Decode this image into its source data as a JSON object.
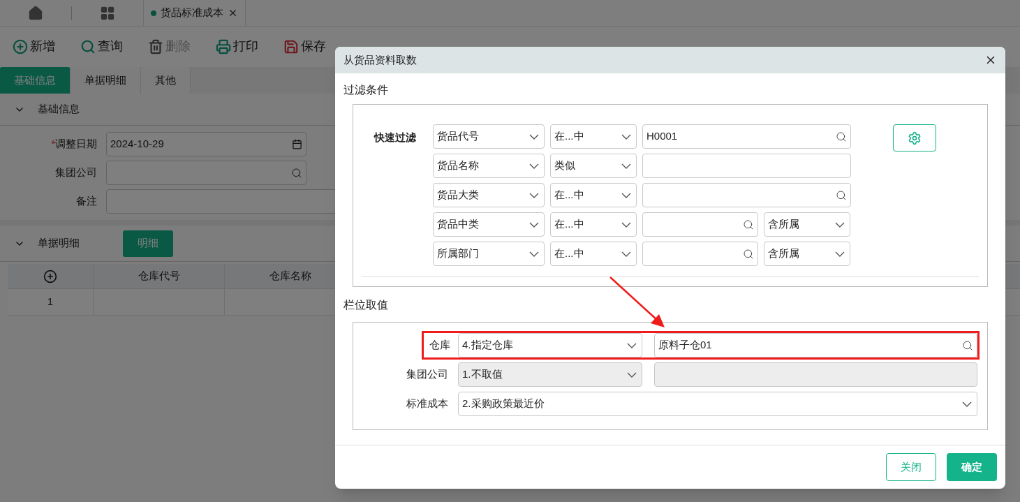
{
  "app_tabs": {
    "document_tab": {
      "label": "货品标准成本"
    }
  },
  "toolbar": [
    {
      "label": "新增",
      "disabled": false
    },
    {
      "label": "查询",
      "disabled": false
    },
    {
      "label": "删除",
      "disabled": true
    },
    {
      "label": "打印",
      "disabled": false
    },
    {
      "label": "保存",
      "disabled": false
    }
  ],
  "form_tabs": [
    {
      "label": "基础信息",
      "selected": true
    },
    {
      "label": "单据明细",
      "selected": false
    },
    {
      "label": "其他",
      "selected": false
    }
  ],
  "basic_section": {
    "title": "基础信息",
    "expanded": true,
    "fields": [
      {
        "label": "调整日期",
        "required_mark": "*",
        "value": "2024-10-29",
        "kind": "date"
      },
      {
        "label": "集团公司",
        "kind": "lookup"
      },
      {
        "label": "备注",
        "kind": "text"
      }
    ]
  },
  "detail_section": {
    "title": "单据明细",
    "expanded": true,
    "button": "明细",
    "table": {
      "columns": [
        "仓库代号",
        "仓库名称"
      ],
      "rows": [
        {
          "index": "1"
        }
      ]
    }
  },
  "dialog": {
    "title": "从货品资料取数",
    "filter_title": "过滤条件",
    "quick_filter_label": "快速过滤",
    "filters": [
      {
        "field": "货品代号",
        "operator": "在...中",
        "value": "H0001",
        "lookup": true
      },
      {
        "field": "货品名称",
        "operator": "类似",
        "lookup": false
      },
      {
        "field": "货品大类",
        "operator": "在...中",
        "lookup": true
      },
      {
        "field": "货品中类",
        "operator": "在...中",
        "lookup": true,
        "scope": "含所属"
      },
      {
        "field": "所属部门",
        "operator": "在...中",
        "lookup": true,
        "scope": "含所属"
      }
    ],
    "column_title": "栏位取值",
    "column_rows": [
      {
        "label": "仓库",
        "mode": "4.指定仓库",
        "value": "原料子仓01",
        "kind": "split",
        "disabled": false,
        "highlighted": true
      },
      {
        "label": "集团公司",
        "mode": "1.不取值",
        "kind": "split",
        "disabled": true,
        "highlighted": false
      },
      {
        "label": "标准成本",
        "mode": "2.采购政策最近价",
        "kind": "full",
        "disabled": false,
        "highlighted": false
      }
    ],
    "buttons": [
      {
        "label": "关闭",
        "kind": "secondary"
      },
      {
        "label": "确定",
        "kind": "primary"
      }
    ]
  }
}
